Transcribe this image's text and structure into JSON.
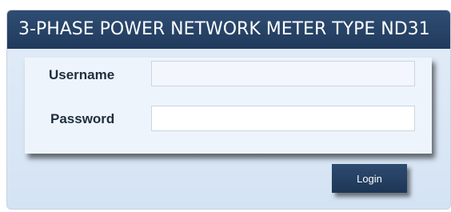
{
  "header": {
    "title": "3-PHASE POWER NETWORK METER TYPE ND31"
  },
  "form": {
    "username_label": "Username",
    "username_value": "",
    "password_label": "Password",
    "password_value": ""
  },
  "actions": {
    "login_label": "Login"
  },
  "colors": {
    "header_bg": "#243f63",
    "panel_bg": "#d8e6f5",
    "button_bg": "#243f63"
  }
}
